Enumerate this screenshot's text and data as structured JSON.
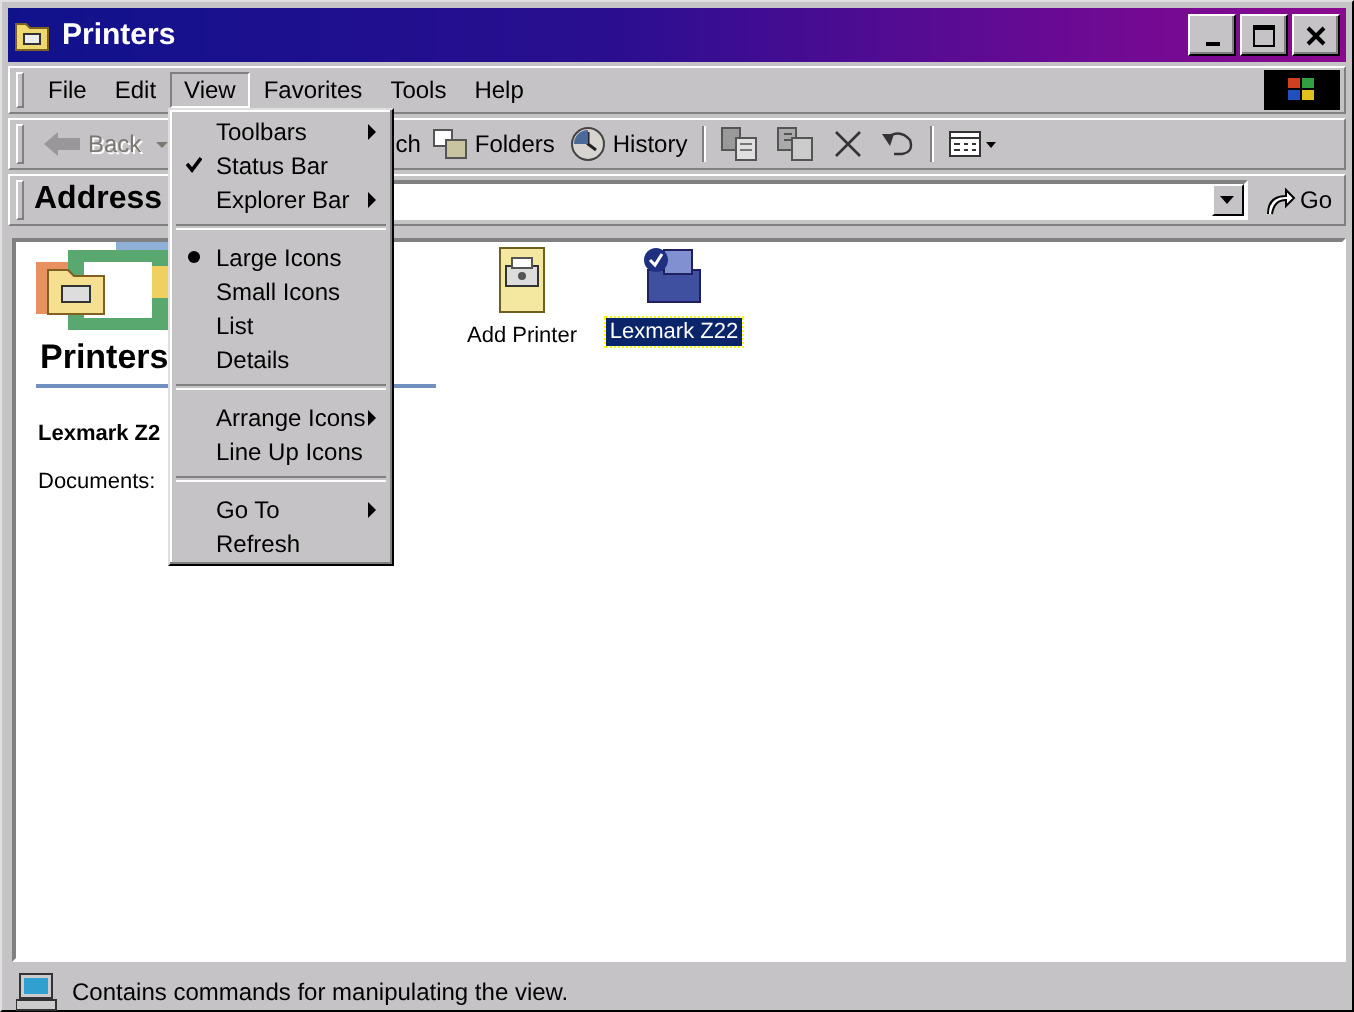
{
  "window": {
    "title": "Printers"
  },
  "menu_bar": [
    {
      "label": "File",
      "open": false
    },
    {
      "label": "Edit",
      "open": false
    },
    {
      "label": "View",
      "open": true
    },
    {
      "label": "Favorites",
      "open": false
    },
    {
      "label": "Tools",
      "open": false
    },
    {
      "label": "Help",
      "open": false
    }
  ],
  "toolbar": [
    {
      "kind": "back",
      "label": "Back",
      "disabled": true
    },
    {
      "kind": "search",
      "label": "ch",
      "disabled": false
    },
    {
      "kind": "folders",
      "label": "Folders",
      "disabled": false
    },
    {
      "kind": "history",
      "label": "History",
      "disabled": false
    },
    {
      "kind": "separator"
    },
    {
      "kind": "move-to",
      "disabled": false
    },
    {
      "kind": "copy-to",
      "disabled": false
    },
    {
      "kind": "delete",
      "disabled": false
    },
    {
      "kind": "undo",
      "disabled": false
    },
    {
      "kind": "separator"
    },
    {
      "kind": "views",
      "disabled": false
    }
  ],
  "address_bar": {
    "label": "Address",
    "go": "Go"
  },
  "info_panel": {
    "heading": "Printers",
    "name": "Lexmark Z2",
    "detail": "Documents:"
  },
  "items": [
    {
      "kind": "add-printer",
      "label": "Add Printer",
      "selected": false
    },
    {
      "kind": "printer",
      "label": "Lexmark Z22",
      "selected": true
    }
  ],
  "view_menu": [
    {
      "kind": "submenu",
      "label": "Toolbars"
    },
    {
      "kind": "check",
      "label": "Status Bar",
      "checked": true
    },
    {
      "kind": "submenu",
      "label": "Explorer Bar"
    },
    {
      "kind": "separator"
    },
    {
      "kind": "radio",
      "label": "Large Icons",
      "selected": true
    },
    {
      "kind": "radio",
      "label": "Small Icons",
      "selected": false
    },
    {
      "kind": "radio",
      "label": "List",
      "selected": false
    },
    {
      "kind": "radio",
      "label": "Details",
      "selected": false
    },
    {
      "kind": "separator"
    },
    {
      "kind": "submenu",
      "label": "Arrange Icons"
    },
    {
      "kind": "command",
      "label": "Line Up Icons"
    },
    {
      "kind": "separator"
    },
    {
      "kind": "submenu",
      "label": "Go To"
    },
    {
      "kind": "command",
      "label": "Refresh"
    }
  ],
  "status_bar": {
    "text": "Contains commands for manipulating the view."
  }
}
